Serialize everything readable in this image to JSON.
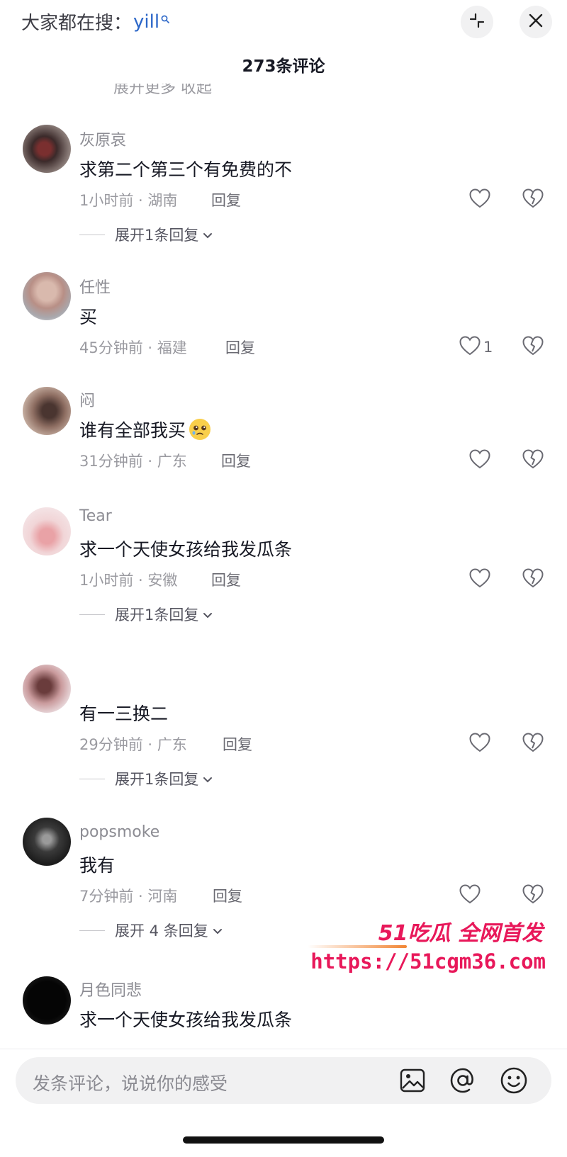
{
  "header": {
    "search_hint_prefix": "大家都在搜：",
    "search_hint_keyword": "yill",
    "comment_count": "273条评论"
  },
  "cut_top_text": "展开更多            收起",
  "comments": [
    {
      "username": "灰原哀",
      "text": "求第二个第三个有免费的不",
      "time_location": "1小时前 · 湖南",
      "reply_label": "回复",
      "like_count": "",
      "expand_label": "展开1条回复"
    },
    {
      "username": "任性",
      "text": "买",
      "time_location": "45分钟前 · 福建",
      "reply_label": "回复",
      "like_count": "1",
      "expand_label": ""
    },
    {
      "username": "闷",
      "text": "谁有全部我买",
      "time_location": "31分钟前 · 广东",
      "reply_label": "回复",
      "like_count": "",
      "expand_label": ""
    },
    {
      "username": "Tear",
      "text": "求一个天使女孩给我发瓜条",
      "time_location": "1小时前 · 安徽",
      "reply_label": "回复",
      "like_count": "",
      "expand_label": "展开1条回复"
    },
    {
      "username": "",
      "text": "有一三换二",
      "time_location": "29分钟前 · 广东",
      "reply_label": "回复",
      "like_count": "",
      "expand_label": "展开1条回复"
    },
    {
      "username": "popsmoke",
      "text": "我有",
      "time_location": "7分钟前 · 河南",
      "reply_label": "回复",
      "like_count": "",
      "expand_label": "展开 4 条回复"
    },
    {
      "username": "月色同悲",
      "text": "求一个天使女孩给我发瓜条",
      "time_location": "",
      "reply_label": "",
      "like_count": "",
      "expand_label": ""
    }
  ],
  "watermark": {
    "title": "51吃瓜 全网首发",
    "url": "https://51cgm36.com"
  },
  "input": {
    "placeholder": "发条评论，说说你的感受"
  },
  "colors": {
    "keyword_blue": "#2b66c8",
    "watermark_pink": "#e8185a",
    "text_primary": "#161823",
    "text_secondary": "#9a9aa0"
  },
  "icons": [
    "search-icon",
    "minimize-icon",
    "close-icon",
    "heart-icon",
    "dislike-icon",
    "chevron-down-icon",
    "image-icon",
    "at-icon",
    "emoji-icon"
  ]
}
